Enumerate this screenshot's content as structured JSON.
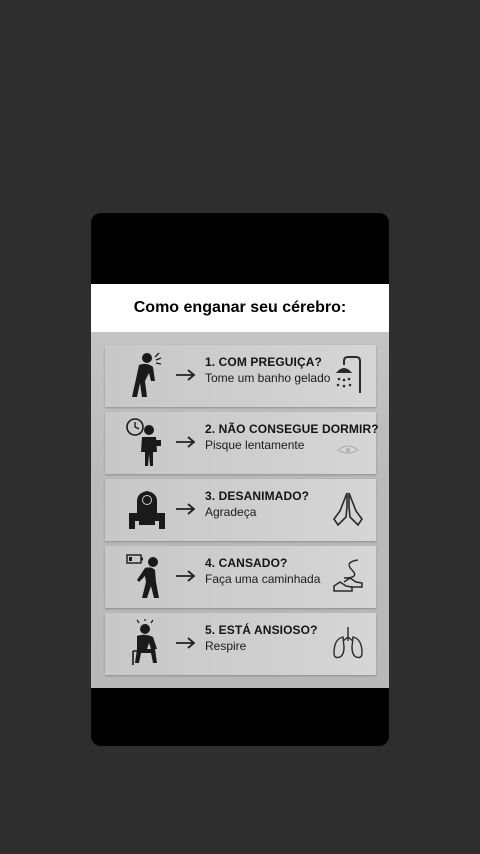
{
  "title": "Como enganar seu cérebro:",
  "items": [
    {
      "heading": "1. COM PREGUIÇA?",
      "text": "Tome um banho gelado",
      "figure_icon": "tired-person-icon",
      "side_icon": "shower-icon"
    },
    {
      "heading": "2. NÃO CONSEGUE DORMIR?",
      "text": "Pisque lentamente",
      "figure_icon": "person-clock-icon",
      "side_icon": "closed-eye-icon"
    },
    {
      "heading": "3. DESANIMADO?",
      "text": "Agradeça",
      "figure_icon": "sitting-sad-person-icon",
      "side_icon": "praying-hands-icon"
    },
    {
      "heading": "4. CANSADO?",
      "text": "Faça uma caminhada",
      "figure_icon": "low-battery-person-icon",
      "side_icon": "sneakers-path-icon"
    },
    {
      "heading": "5. ESTÁ ANSIOSO?",
      "text": "Respire",
      "figure_icon": "anxious-person-icon",
      "side_icon": "lungs-icon"
    }
  ],
  "colors": {
    "page_bg": "#2e2e2e",
    "card_bg": "#000000",
    "content_bg": "#bdbdbd",
    "text": "#141414"
  }
}
